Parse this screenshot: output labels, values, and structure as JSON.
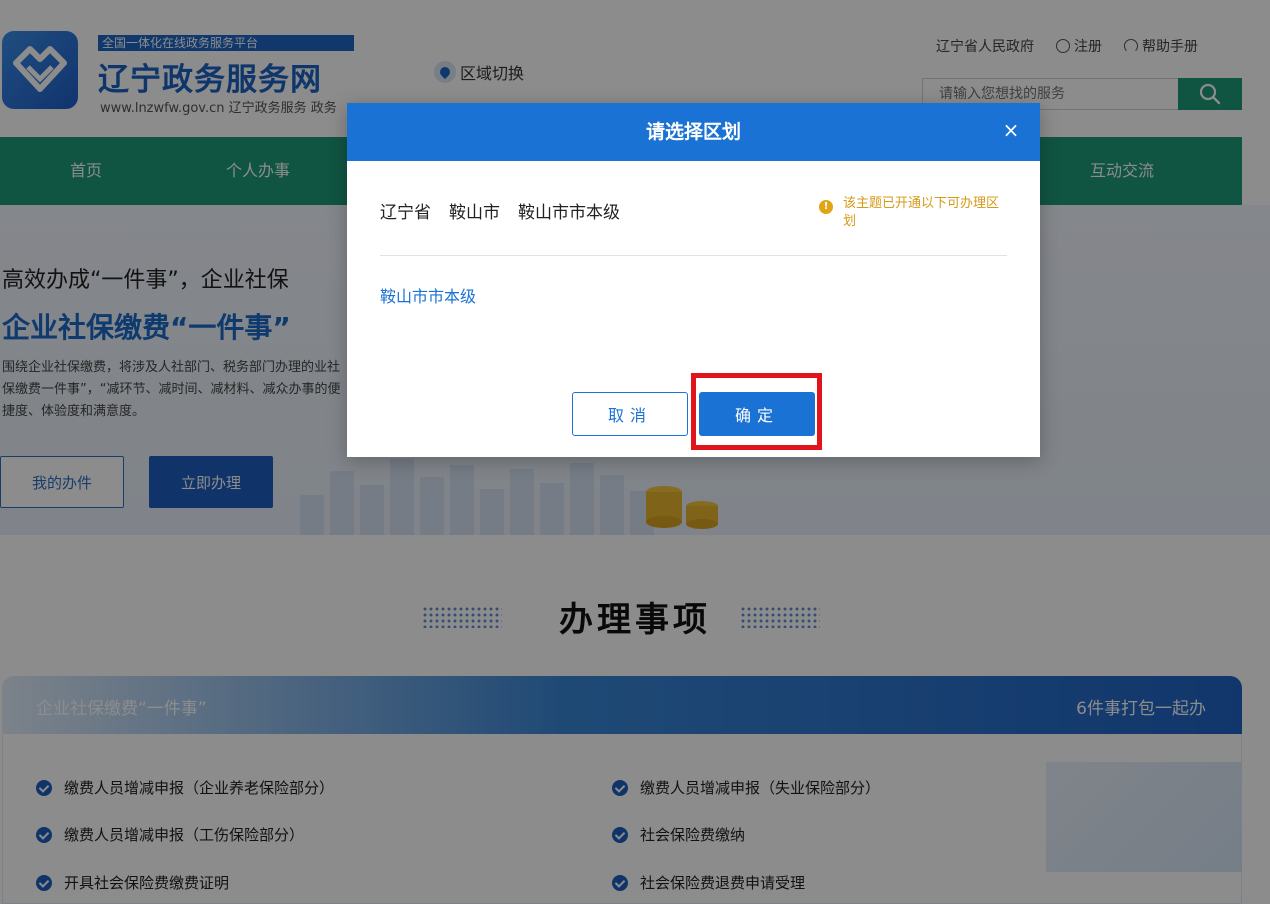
{
  "header": {
    "platform_tag": "全国一体化在线政务服务平台",
    "site_title": "辽宁政务服务网",
    "site_url": "www.lnzwfw.gov.cn   辽宁政务服务 政务",
    "region_switch": "区域切换",
    "links": {
      "gov": "辽宁省人民政府",
      "register": "注册",
      "help": "帮助手册"
    },
    "search_placeholder": "请输入您想找的服务",
    "brand_color": "#1a63c4"
  },
  "nav": {
    "items": [
      "首页",
      "个人办事",
      "互动交流"
    ],
    "color": "#1e9a78"
  },
  "hero": {
    "title_line1": "高效办成“一件事”，企业社保",
    "title_line2": "企业社保缴费“一件事”",
    "desc": "围绕企业社保缴费，将涉及人社部门、税务部门办理的业社保缴费一件事”，“减环节、减时间、减材料、减众办事的便捷度、体验度和满意度。",
    "btn_mine": "我的办件",
    "btn_go": "立即办理"
  },
  "section": {
    "title": "办理事项",
    "panel_left": "企业社保缴费“一件事”",
    "panel_right": "6件事打包一起办",
    "items": [
      "缴费人员增减申报（企业养老保险部分）",
      "缴费人员增减申报（失业保险部分）",
      "缴费人员增减申报（工伤保险部分）",
      "社会保险费缴纳",
      "开具社会保险费缴费证明",
      "社会保险费退费申请受理"
    ]
  },
  "modal": {
    "title": "请选择区划",
    "close": "×",
    "crumbs": [
      "辽宁省",
      "鞍山市",
      "鞍山市市本级"
    ],
    "notice": "该主题已开通以下可办理区划",
    "option": "鞍山市市本级",
    "cancel": "取消",
    "ok": "确定",
    "accent_color": "#1a72d4",
    "highlight_color": "#e2141b"
  }
}
